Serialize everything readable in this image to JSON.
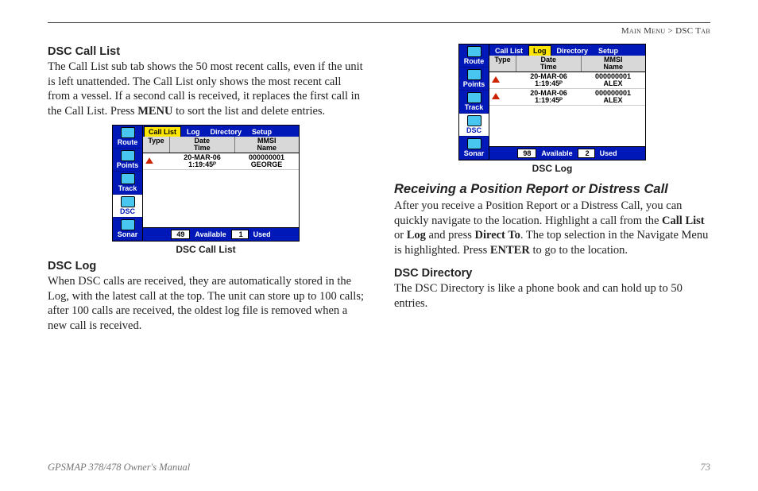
{
  "header": {
    "crumb1": "Main Menu",
    "sep": " > ",
    "crumb2": "DSC Tab"
  },
  "left": {
    "h1": "DSC Call List",
    "p1a": "The Call List sub tab shows the 50 most recent calls, even if the unit is left unattended. The Call List only shows the most recent call from a vessel. If a second call is received, it replaces the first call in the Call List. Press ",
    "p1b": "MENU",
    "p1c": " to sort the list and delete entries.",
    "fig1_caption": "DSC Call List",
    "h2": "DSC Log",
    "p2": "When DSC calls are received, they are automatically stored in the Log, with the latest call at the top. The unit can store up to 100 calls; after 100 calls are received, the oldest log file is removed when a new call is received."
  },
  "right": {
    "fig2_caption": "DSC Log",
    "h1": "Receiving a Position Report or Distress Call",
    "p1a": "After you receive a Position Report or a Distress Call, you can quickly navigate to the location. Highlight a call from the ",
    "p1b": "Call List",
    "p1c": " or ",
    "p1d": "Log",
    "p1e": " and press ",
    "p1f": "Direct To",
    "p1g": ". The top selection in the Navigate Menu is highlighted. Press ",
    "p1h": "ENTER",
    "p1i": " to go to the location.",
    "h2": "DSC Directory",
    "p2": "The DSC Directory is like a phone book and can hold up to 50 entries."
  },
  "device": {
    "sidebar": [
      "Route",
      "Points",
      "Track",
      "DSC",
      "Sonar"
    ],
    "tabs": [
      "Call List",
      "Log",
      "Directory",
      "Setup"
    ],
    "headers": {
      "type": "Type",
      "date": "Date\nTime",
      "mmsi": "MMSI\nName"
    },
    "status": {
      "avail_label": "Available",
      "used_label": "Used"
    }
  },
  "fig1": {
    "activeTab": "Call List",
    "rows": [
      {
        "date": "20-MAR-06",
        "time": "1:19:45ᴾ",
        "mmsi": "000000001",
        "name": "GEORGE"
      }
    ],
    "avail": "49",
    "used": "1"
  },
  "fig2": {
    "activeTab": "Log",
    "rows": [
      {
        "date": "20-MAR-06",
        "time": "1:19:45ᴾ",
        "mmsi": "000000001",
        "name": "ALEX"
      },
      {
        "date": "20-MAR-06",
        "time": "1:19:45ᴾ",
        "mmsi": "000000001",
        "name": "ALEX"
      }
    ],
    "avail": "98",
    "used": "2"
  },
  "footer": {
    "left": "GPSMAP 378/478 Owner's Manual",
    "page": "73"
  }
}
